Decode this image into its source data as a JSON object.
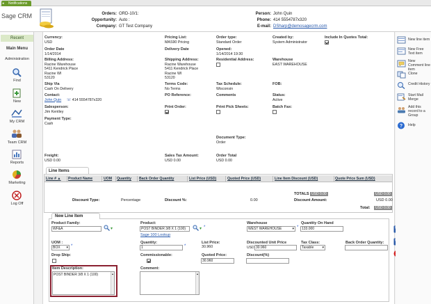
{
  "topbar": {
    "notifications_label": "Notifications"
  },
  "app": {
    "logo_text": "Sage CRM"
  },
  "header": {
    "orders_label": "Orders:",
    "orders_value": "ORD-10/1:",
    "opportunity_label": "Opportunity:",
    "opportunity_value": "Auto :",
    "company_label": "Company:",
    "company_value": "GT Test Company",
    "person_label": "Person:",
    "person_value": "John Quin",
    "phone_label": "Phone:",
    "phone_value": "414 5554787x320",
    "email_label": "E-mail:",
    "email_value": "DSharp@demosagecrm.com"
  },
  "sidebar": {
    "recent": "Recent",
    "main_menu": "Main Menu",
    "administration": "Administration",
    "items": [
      {
        "label": "Find",
        "icon": "magnifier-icon"
      },
      {
        "label": "New",
        "icon": "new-record-icon"
      },
      {
        "label": "My CRM",
        "icon": "my-crm-icon"
      },
      {
        "label": "Team CRM",
        "icon": "team-crm-icon"
      },
      {
        "label": "Reports",
        "icon": "reports-icon"
      },
      {
        "label": "Marketing",
        "icon": "marketing-pie-icon"
      },
      {
        "label": "Log Off",
        "icon": "log-off-icon"
      }
    ]
  },
  "order": {
    "currency_label": "Currency:",
    "currency_value": "USD",
    "pricing_list_label": "Pricing List:",
    "pricing_list_value": "MAS90 Pricing",
    "order_type_label": "Order type:",
    "order_type_value": "Standard Order",
    "created_by_label": "Created by:",
    "created_by_value": "System Administrator",
    "include_quotes_label": "Include In Quotes Total:",
    "order_date_label": "Order Date",
    "order_date_value": "1/14/2014",
    "delivery_date_label": "Delivery Date",
    "opened_label": "Opened:",
    "opened_value": "1/14/2014 19:30",
    "billing_label": "Billing Address:",
    "billing_lines": [
      "Racine Warehouse",
      "5411 Kendrick Place",
      "Racine WI",
      "53120"
    ],
    "shipping_label": "Shipping Address:",
    "shipping_lines": [
      "Racine Warehouse",
      "5411 Kendrick Place",
      "Racine WI",
      "53120"
    ],
    "residential_label": "Residential Address:",
    "warehouse_label": "Warehouse",
    "warehouse_value": "EAST WAREHOUSE",
    "ship_via_label": "Ship Via",
    "ship_via_value": "Cash On Delivery",
    "terms_label": "Terms Code:",
    "terms_value": "No Terms",
    "tax_schedule_label": "Tax Schedule:",
    "tax_schedule_value": "Wisconsin",
    "fob_label": "FOB:",
    "contact_label": "Contact:",
    "contact_value": "John Quin",
    "contact_phone": "414 5554787x320",
    "po_label": "PO Reference:",
    "comments_label": "Comments",
    "status_label": "Status:",
    "status_value": "Active",
    "salesperson_label": "Salesperson:",
    "salesperson_value": "Jim Kentley",
    "print_order_label": "Print Order:",
    "print_pick_label": "Print Pick Sheets:",
    "batch_fax_label": "Batch Fax:",
    "payment_type_label": "Payment Type:",
    "payment_type_value": "Cash",
    "document_type_label": "Document Type:",
    "document_type_value": "Order",
    "freight_label": "Freight:",
    "freight_value": "USD 0.00",
    "sales_tax_label": "Sales Tax Amount:",
    "sales_tax_value": "USD 0.00",
    "order_total_label": "Order Total",
    "order_total_value": "USD 0.00"
  },
  "line_items": {
    "tab_label": "Line Items",
    "columns": [
      "Line # ▲",
      "Product Name",
      "UOM",
      "Quantity",
      "Back Order Quantity",
      "List Price (USD)",
      "Quoted Price (USD)",
      "Line Item Discount (USD)",
      "Quote Price Sum (USD)"
    ],
    "totals_label": "TOTALS",
    "totals_value_1": "USD 0.00",
    "totals_value_2": "USD 0.00",
    "discount_type_label": "Discount Type:",
    "discount_type_value": "Percentage",
    "discount_pct_label": "Discount %:",
    "discount_pct_value": "0.00",
    "discount_amount_label": "Discount Amount:",
    "discount_amount_value": "USD 0.00",
    "total_label": "Total:",
    "total_value": "USD 0.00"
  },
  "new_line_item": {
    "tab_label": "New Line Item",
    "product_family_label": "Product Family:",
    "product_family_value": "WF&A",
    "product_label": "Product:",
    "product_value": "POST BINDER 3/8 X 1 (100)",
    "sage_lookup": "Sage 100 Lookup",
    "warehouse_label": "Warehouse",
    "warehouse_value": "WEST WAREHOUSE",
    "qty_on_hand_label": "Quantity On Hand",
    "qty_on_hand_value": "133.000",
    "uom_label": "UOM :",
    "uom_value": "BOX",
    "quantity_label": "Quantity:",
    "quantity_value": "1",
    "list_price_label": "List Price:",
    "list_price_value": "30.960",
    "discounted_label": "Discounted Unit Price",
    "discounted_currency": "USD",
    "discounted_value": "30.960",
    "tax_class_label": "Tax Class:",
    "tax_class_value": "Taxable",
    "back_order_label": "Back Order Quantity:",
    "drop_ship_label": "Drop Ship:",
    "commissionable_label": "Commissionable:",
    "quoted_price_label": "Quoted Price:",
    "quoted_price_value": "30.960",
    "discount_label": "Discount(%)",
    "item_desc_label": "Item Description:",
    "item_desc_value": "POST BINDER 3/8 X 1 (100)",
    "comment_label": "Comment:"
  },
  "actions": [
    {
      "label": "New line item",
      "icon": "new-line-item-icon"
    },
    {
      "label": "New Free Text item",
      "icon": "new-free-text-icon"
    },
    {
      "label": "New Comment line item",
      "icon": "new-comment-icon"
    },
    {
      "label": "Clone",
      "icon": "clone-icon"
    },
    {
      "label": "Credit History",
      "icon": "credit-history-icon"
    },
    {
      "label": "Start Mail Merge",
      "icon": "mail-merge-icon"
    },
    {
      "label": "Add this record to a Group",
      "icon": "add-to-group-icon"
    },
    {
      "label": "Help",
      "icon": "help-icon"
    }
  ],
  "colors": {
    "accent_green": "#6a9a2a",
    "link_blue": "#2255aa",
    "highlight_red": "#8a2030"
  }
}
